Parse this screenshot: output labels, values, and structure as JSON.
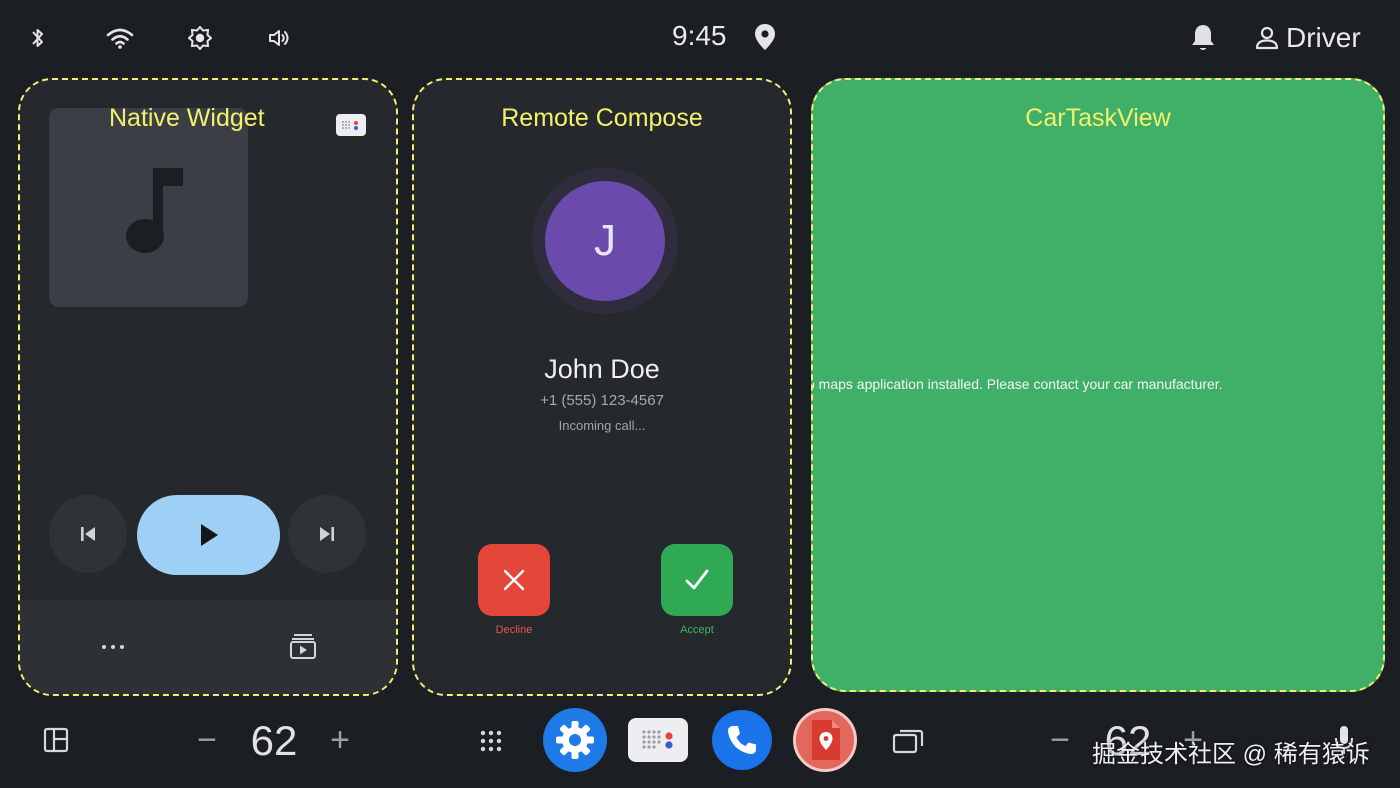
{
  "status_bar": {
    "time": "9:45",
    "user_label": "Driver",
    "icons": [
      "bluetooth-icon",
      "wifi-icon",
      "brightness-icon",
      "volume-icon",
      "location-icon",
      "bell-icon",
      "person-icon"
    ]
  },
  "panels": {
    "native_widget": {
      "title": "Native Widget",
      "icons": [
        "music-note-icon",
        "skip-previous-icon",
        "play-icon",
        "skip-next-icon",
        "more-horiz-icon",
        "queue-play-icon"
      ]
    },
    "remote_compose": {
      "title": "Remote Compose",
      "avatar_initial": "J",
      "caller_name": "John Doe",
      "caller_number": "+1 (555) 123-4567",
      "call_status": "Incoming call...",
      "decline_label": "Decline",
      "accept_label": "Accept"
    },
    "car_task_view": {
      "title": "CarTaskView",
      "message": "o maps application installed. Please contact your car manufacturer."
    }
  },
  "bottom_bar": {
    "left_temperature": "62",
    "right_temperature": "62",
    "minus": "−",
    "plus": "+",
    "watermark": "掘金技术社区 @ 稀有猿诉"
  },
  "colors": {
    "background": "#1b1e22",
    "panel": "#25282c",
    "dashed_border": "#f2ef72",
    "task_view_green": "#40b068",
    "play_button": "#9ecff5",
    "decline": "#e4463a",
    "accept": "#2fa953",
    "avatar": "#6a4bab"
  }
}
